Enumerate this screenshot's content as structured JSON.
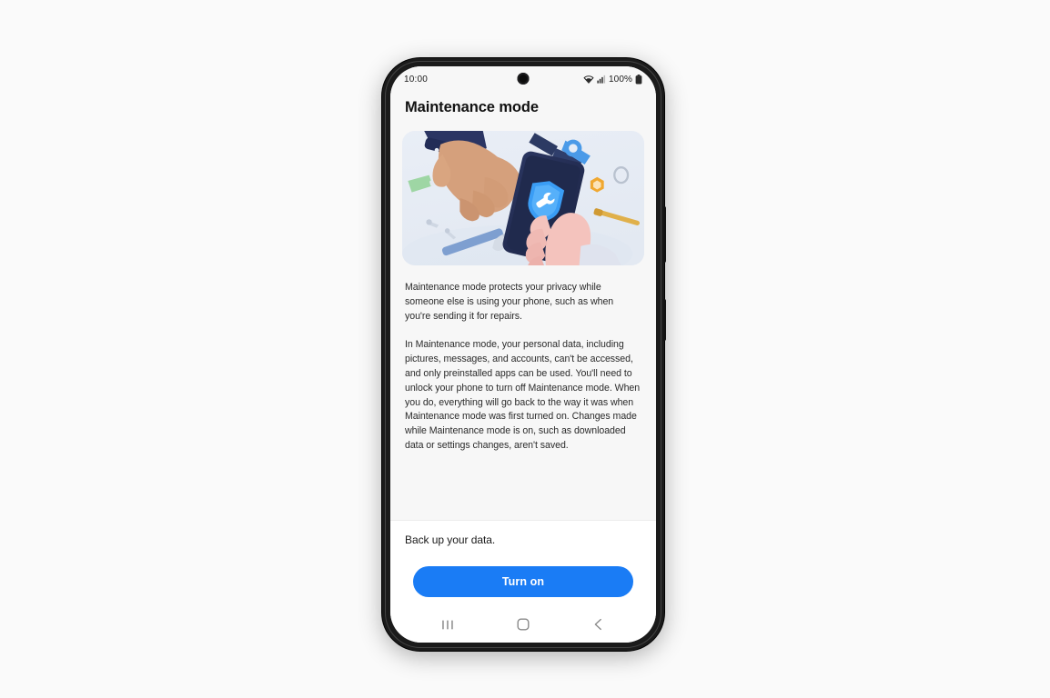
{
  "device": {
    "name": "smartphone-mockup",
    "frame_color": "#1b1b1b",
    "side_buttons": [
      "volume-button",
      "power-button"
    ]
  },
  "status_bar": {
    "time": "10:00",
    "battery_text": "100%",
    "icons": [
      "wifi-icon",
      "cellular-signal-icon",
      "battery-icon"
    ],
    "camera": "front-camera-punch-hole"
  },
  "screen": {
    "title": "Maintenance mode",
    "background": "#f7f7f7"
  },
  "illustration": {
    "name": "maintenance-mode-illustration",
    "alt": "Two hands exchanging a phone showing a shield with a wrench, surrounded by repair tools",
    "background": "#e8edf5",
    "elements": [
      "technician-hand",
      "customer-hand",
      "phone-with-shield-wrench-icon",
      "screwdriver",
      "hammer",
      "pliers",
      "hex-nut",
      "washer",
      "screw",
      "nails"
    ],
    "colors": {
      "panel_bg": "#e8edf5",
      "phone_body": "#242e52",
      "shield": "#3a9df5",
      "wrench": "#ffffff",
      "sleeve": "#2b3563",
      "skin_left": "#d5a07c",
      "skin_right": "#f4c3bd",
      "screwdriver_handle": "#9ed6a4",
      "hammer_handle": "#7e9fd0",
      "nut": "#f0a830",
      "screw": "#e0b04a"
    }
  },
  "body": {
    "paragraph_1": "Maintenance mode protects your privacy while someone else is using your phone, such as when you're sending it for repairs.",
    "paragraph_2": "In Maintenance mode, your personal data, including pictures, messages, and accounts, can't be accessed, and only preinstalled apps can be used. You'll need to unlock your phone to turn off Maintenance mode. When you do, everything will go back to the way it was when Maintenance mode was first turned on. Changes made while Maintenance mode is on, such as downloaded data or settings changes, aren't saved."
  },
  "backup": {
    "label": "Back up your data."
  },
  "action_bar": {
    "primary_label": "Turn on",
    "primary_color": "#1a7cf5"
  },
  "nav_bar": {
    "items": [
      {
        "name": "recents",
        "icon": "recents-icon"
      },
      {
        "name": "home",
        "icon": "home-icon"
      },
      {
        "name": "back",
        "icon": "back-chevron-icon"
      }
    ]
  }
}
